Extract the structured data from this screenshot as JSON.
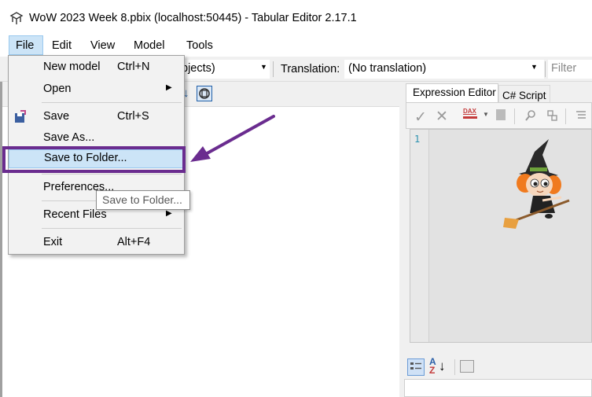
{
  "window": {
    "title": "WoW 2023 Week 8.pbix (localhost:50445) - Tabular Editor 2.17.1"
  },
  "menubar": {
    "items": [
      "File",
      "Edit",
      "View",
      "Model",
      "Tools"
    ]
  },
  "toolbar": {
    "perspective_value": "bjects)",
    "translation_label": "Translation:",
    "translation_value": "(No translation)",
    "filter_placeholder": "Filter"
  },
  "file_menu": {
    "items": [
      {
        "label": "New model",
        "shortcut": "Ctrl+N"
      },
      {
        "label": "Open",
        "shortcut": "",
        "submenu": true
      },
      {
        "label": "Save",
        "shortcut": "Ctrl+S"
      },
      {
        "label": "Save As...",
        "shortcut": ""
      },
      {
        "label": "Save to Folder...",
        "shortcut": "",
        "highlighted": true
      },
      {
        "label": "Preferences...",
        "shortcut": ""
      },
      {
        "label": "Recent Files",
        "shortcut": "",
        "submenu": true
      },
      {
        "label": "Exit",
        "shortcut": "Alt+F4"
      }
    ]
  },
  "tooltip": {
    "text": "Save to Folder..."
  },
  "editor": {
    "tabs": [
      "Expression Editor",
      "C# Script"
    ],
    "active_tab": "Expression Editor",
    "line_numbers": [
      "1"
    ],
    "dax_badge": "DAX"
  },
  "annotation": {
    "highlight_color": "#6a2c8f",
    "arrow_color": "#6a2c8f"
  },
  "icons": [
    "app-logo-icon",
    "save-disk-icon",
    "check-icon",
    "cancel-x-icon",
    "dax-formatter-icon",
    "search-icon",
    "sort-az-icon",
    "categorized-icon",
    "witch-mascot"
  ]
}
